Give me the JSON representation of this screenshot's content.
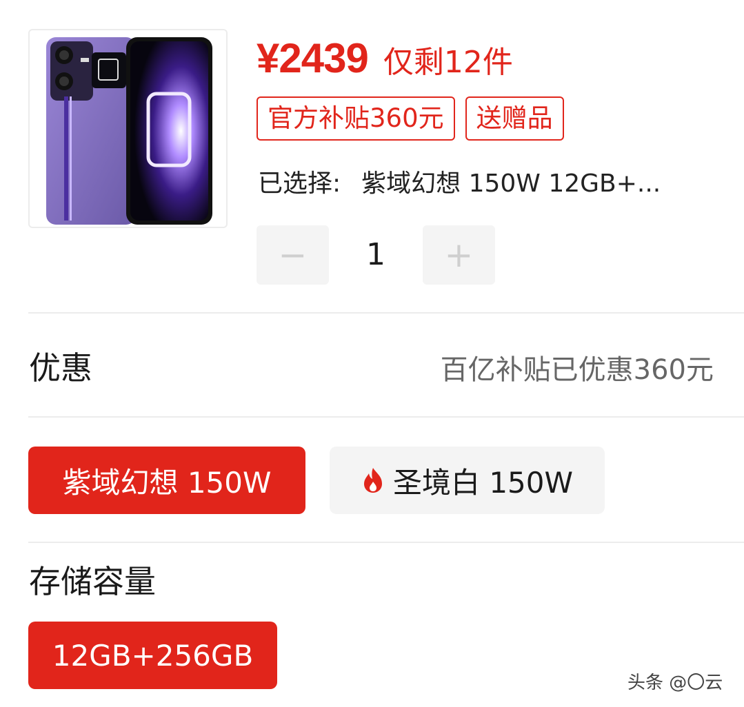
{
  "product": {
    "image_alt": "realme 手机 紫色",
    "price": "¥2439",
    "stock_text": "仅剩12件",
    "tags": [
      "官方补贴360元",
      "送赠品"
    ],
    "selected_label": "已选择:",
    "selected_value": "紫域幻想 150W 12GB+..."
  },
  "quantity": {
    "minus_label": "−",
    "value": "1",
    "plus_label": "+"
  },
  "promo": {
    "label": "优惠",
    "value": "百亿补贴已优惠360元"
  },
  "color_options": [
    {
      "label": "紫域幻想 150W",
      "selected": true,
      "icon": null
    },
    {
      "label": "圣境白 150W",
      "selected": false,
      "icon": "flame-icon"
    }
  ],
  "storage": {
    "label": "存储容量",
    "options": [
      {
        "label": "12GB+256GB",
        "selected": true
      }
    ]
  },
  "watermark": "头条 @〇云",
  "colors": {
    "accent": "#e1251b",
    "chip_bg": "#f4f4f4",
    "muted_text": "#666666"
  }
}
